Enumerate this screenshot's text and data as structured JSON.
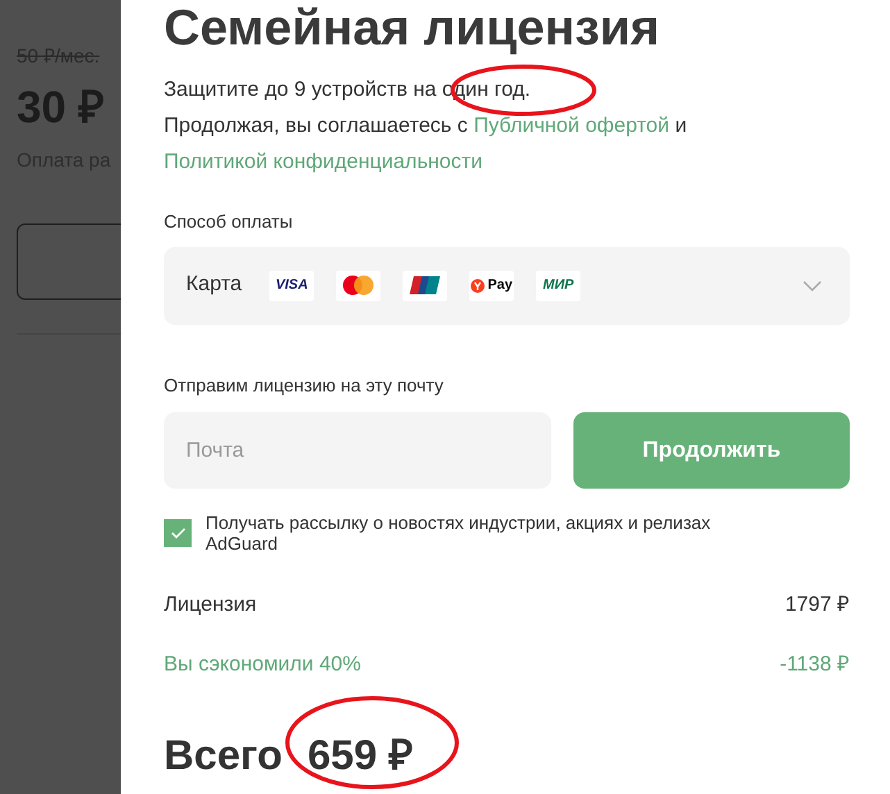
{
  "background_page": {
    "old_price": "50 ₽/мес.",
    "price": "30 ₽",
    "note": "Оплата ра"
  },
  "title": "Семейная лицензия",
  "intro": {
    "line": "Защитите до 9 устройств на один год.",
    "consent_before": "Продолжая, вы соглашаетесь с",
    "offer_link": "Публичной офертой",
    "consent_and": "и",
    "privacy_link": "Политикой конфиденциальности"
  },
  "payment": {
    "label": "Способ оплаты",
    "method": "Карта",
    "logos": [
      {
        "kind": "visa",
        "text": "VISA"
      },
      {
        "kind": "mastercard"
      },
      {
        "kind": "unionpay"
      },
      {
        "kind": "pay",
        "text": "Pay"
      },
      {
        "kind": "mir",
        "text": "МИР"
      }
    ]
  },
  "email": {
    "label": "Отправим лицензию на эту почту",
    "placeholder": "Почта",
    "button": "Продолжить"
  },
  "newsletter": {
    "checked": true,
    "text": "Получать рассылку о новостях индустрии, акциях и релизах AdGuard"
  },
  "summary": [
    {
      "kind": "plain",
      "label": "Лицензия",
      "value": "1797 ₽"
    },
    {
      "kind": "discount",
      "label": "Вы сэкономили 40%",
      "value": "-1138 ₽"
    }
  ],
  "total": {
    "label": "Всего",
    "value": "659 ₽"
  }
}
